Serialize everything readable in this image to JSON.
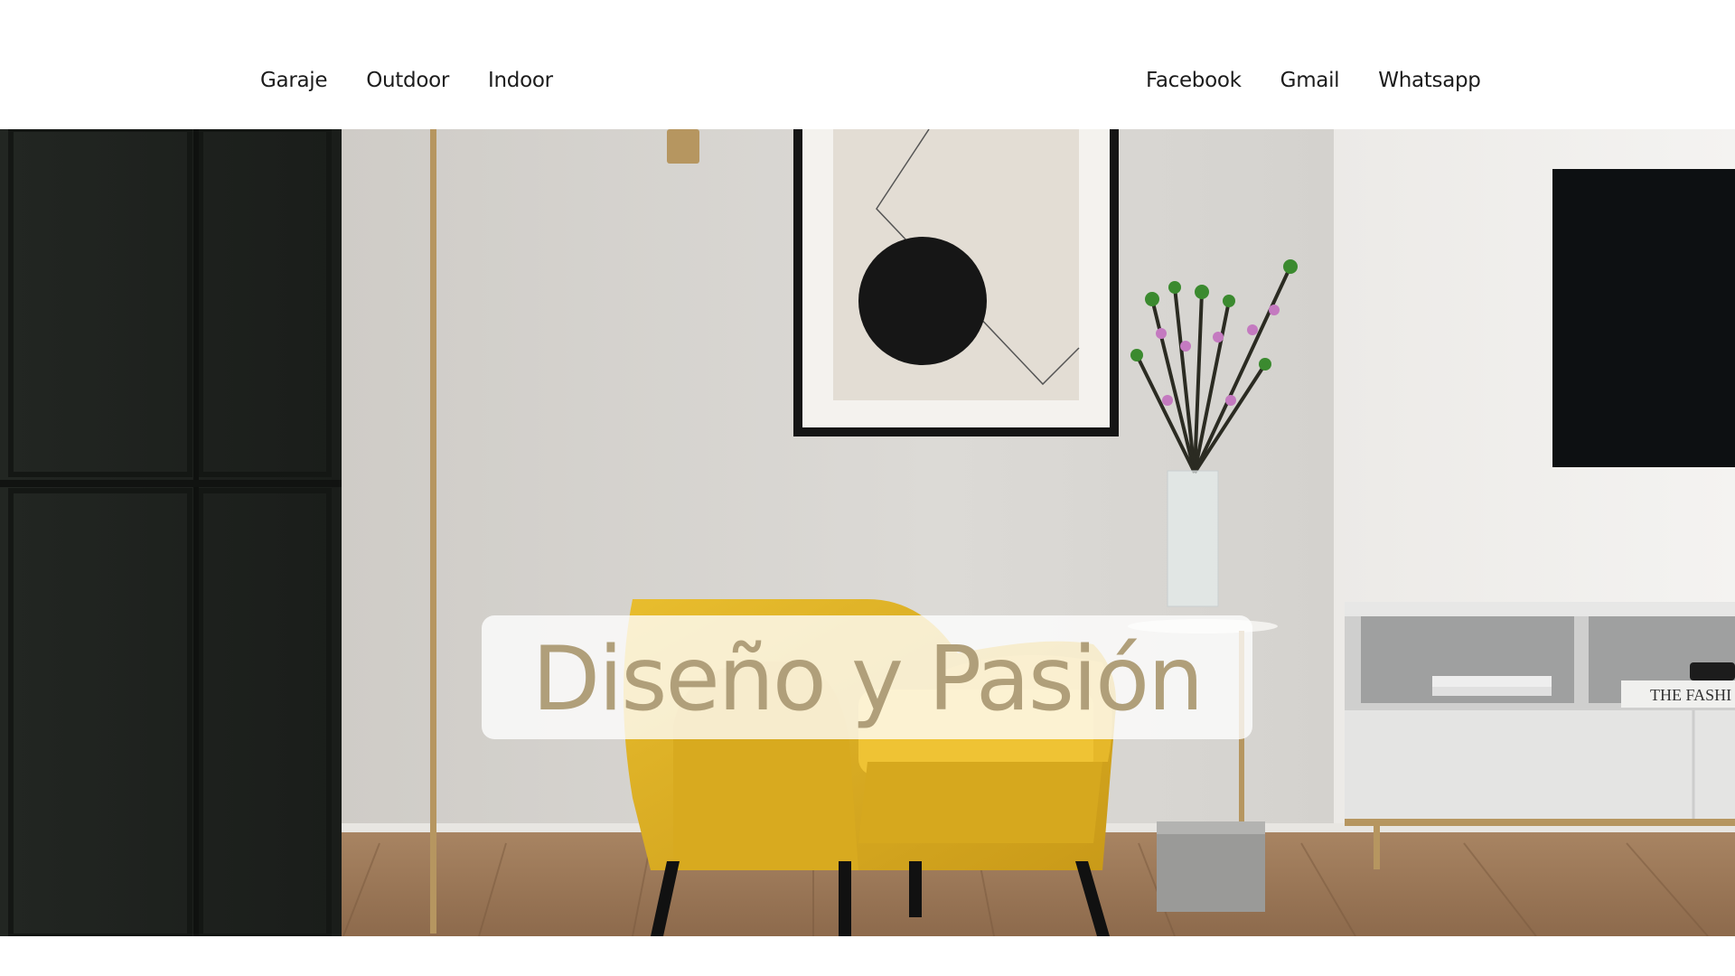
{
  "nav": {
    "left": [
      "Garaje",
      "Outdoor",
      "Indoor"
    ],
    "right": [
      "Facebook",
      "Gmail",
      "Whatsapp"
    ]
  },
  "hero": {
    "title": "Diseño y Pasión",
    "image_label": "living-room-photo",
    "book_text": "THE FASHI"
  },
  "colors": {
    "title": "#b09f7a",
    "chair": "#e0b324",
    "wall": "#d9d7d3",
    "cabinet": "#1f2320"
  }
}
